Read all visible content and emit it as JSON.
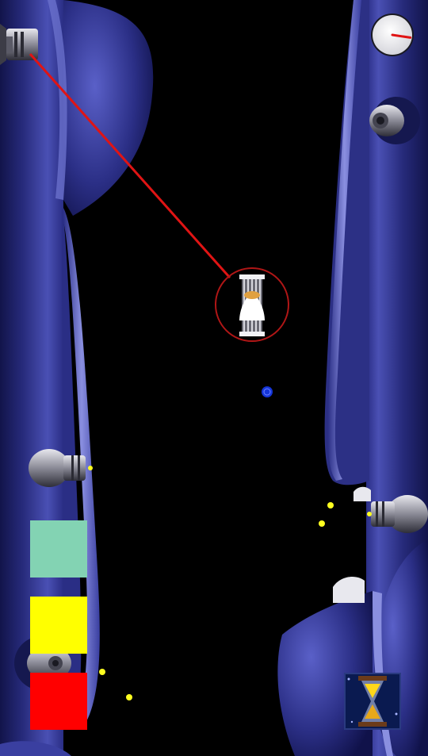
{
  "game": {
    "colors": {
      "background": "#000000",
      "wall_dark": "#1c1f63",
      "wall_mid": "#3a3f9c",
      "wall_light": "#7d82d8",
      "wall_highlight": "#c7caf5",
      "laser": "#e01414",
      "target_ring": "#b01616",
      "orb": "#1535d8",
      "dot": "#ffff20"
    },
    "controls": [
      {
        "id": "mint",
        "color": "#83d3b3"
      },
      {
        "id": "yellow",
        "color": "#ffff00"
      },
      {
        "id": "red",
        "color": "#ff0000"
      }
    ],
    "gauge": {
      "needle_color": "#e01414",
      "level": 0.25
    },
    "icons": {
      "timer": "hourglass-icon",
      "gauge": "dial-gauge-icon",
      "player": "rocket-ship-icon"
    }
  }
}
